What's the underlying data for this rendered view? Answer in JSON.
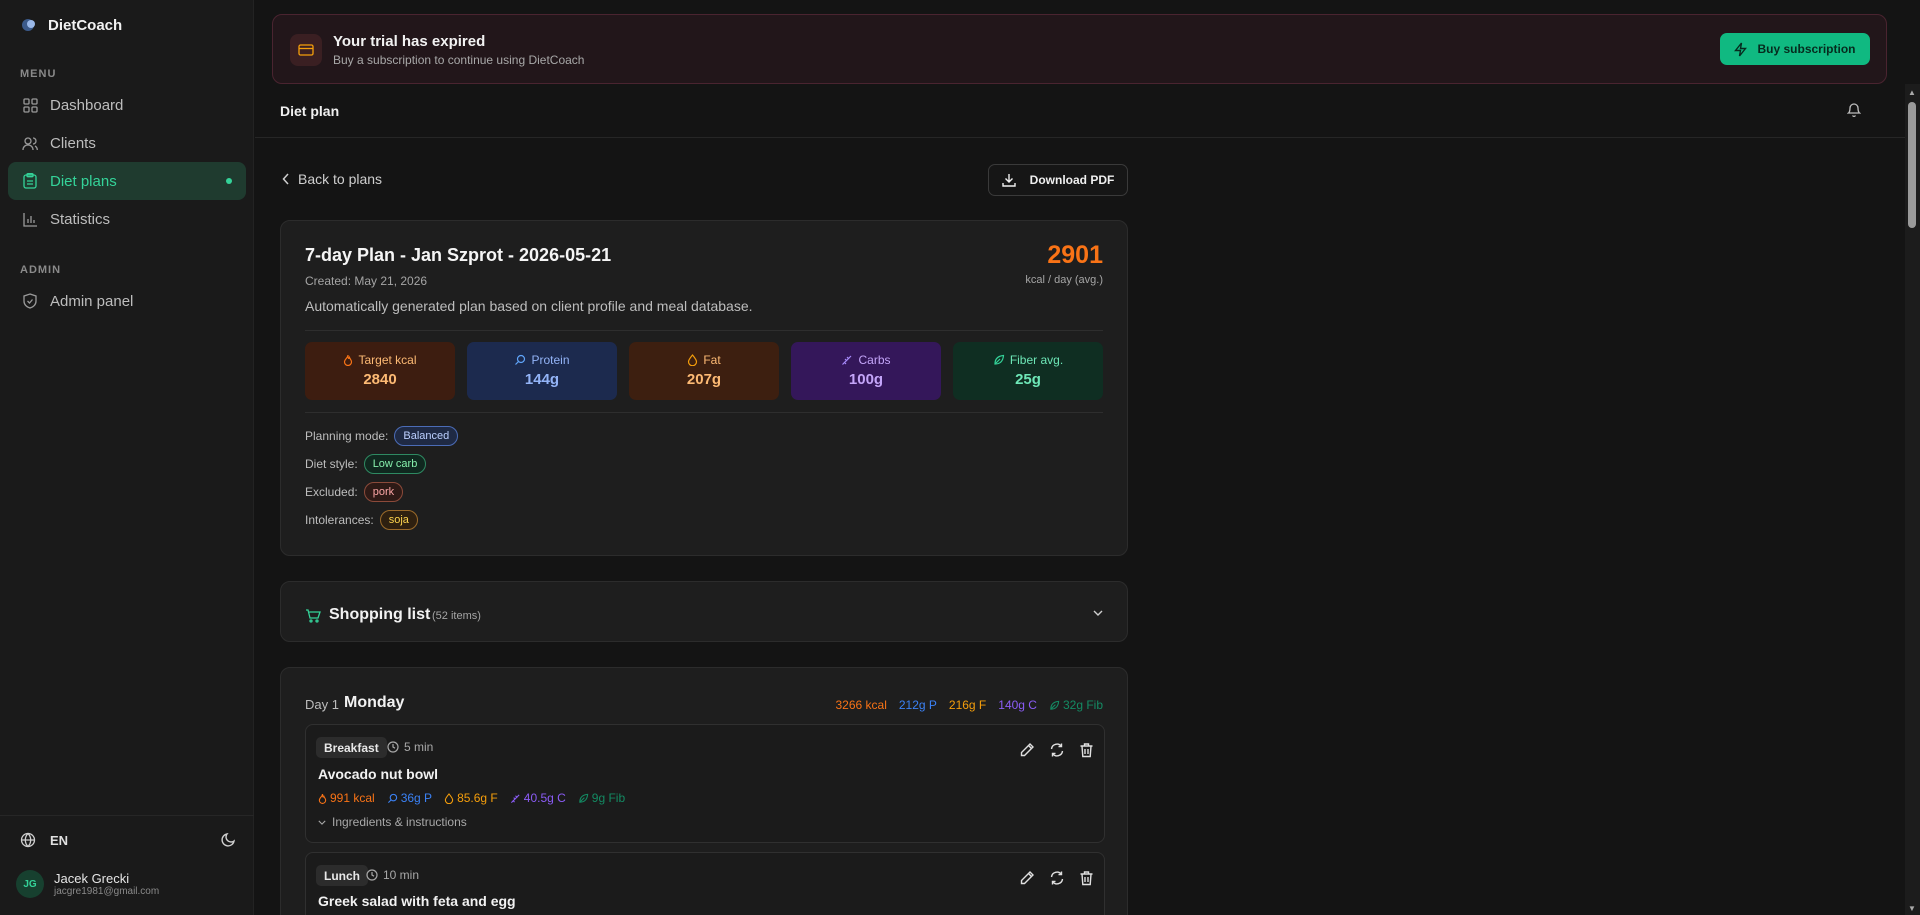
{
  "app": {
    "name": "DietCoach"
  },
  "sidebar": {
    "menu_label": "MENU",
    "items": [
      {
        "label": "Dashboard",
        "icon": "grid-icon"
      },
      {
        "label": "Clients",
        "icon": "users-icon"
      },
      {
        "label": "Diet plans",
        "icon": "clipboard-icon",
        "active": true
      },
      {
        "label": "Statistics",
        "icon": "bar-chart-icon"
      }
    ],
    "admin_label": "ADMIN",
    "admin_items": [
      {
        "label": "Admin panel",
        "icon": "shield-icon"
      }
    ],
    "language": "EN",
    "user": {
      "initials": "JG",
      "name": "Jacek Grecki",
      "email": "jacgre1981@gmail.com"
    }
  },
  "banner": {
    "title": "Your trial has expired",
    "subtitle": "Buy a subscription to continue using DietCoach",
    "button": "Buy subscription"
  },
  "topbar": {
    "title": "Diet plan"
  },
  "actions": {
    "back": "Back to plans",
    "download": "Download PDF"
  },
  "plan": {
    "title": "7-day Plan - Jan Szprot - 2026-05-21",
    "created": "Created: May 21, 2026",
    "description": "Automatically generated plan based on client profile and meal database.",
    "kcal_avg": "2901",
    "kcal_unit": "kcal / day (avg.)",
    "macros": [
      {
        "label": "Target kcal",
        "value": "2840"
      },
      {
        "label": "Protein",
        "value": "144g"
      },
      {
        "label": "Fat",
        "value": "207g"
      },
      {
        "label": "Carbs",
        "value": "100g"
      },
      {
        "label": "Fiber avg.",
        "value": "25g"
      }
    ],
    "properties": [
      {
        "label": "Planning mode:",
        "value": "Balanced"
      },
      {
        "label": "Diet style:",
        "value": "Low carb"
      },
      {
        "label": "Excluded:",
        "value": "pork"
      },
      {
        "label": "Intolerances:",
        "value": "soja"
      }
    ]
  },
  "shopping": {
    "title": "Shopping list",
    "count": "(52 items)"
  },
  "day": {
    "label": "Day 1",
    "name": "Monday",
    "kcal": "3266 kcal",
    "protein": "212g P",
    "fat": "216g F",
    "carbs": "140g C",
    "fiber": "32g Fib",
    "meals": [
      {
        "tag": "Breakfast",
        "time": "5 min",
        "name": "Avocado nut bowl",
        "kcal": "991 kcal",
        "protein": "36g P",
        "fat": "85.6g F",
        "carbs": "40.5g C",
        "fiber": "9g Fib",
        "ingredients_label": "Ingredients & instructions"
      },
      {
        "tag": "Lunch",
        "time": "10 min",
        "name": "Greek salad with feta and egg"
      }
    ]
  },
  "colors": {
    "accent": "#10b981",
    "kcal": "#f97316",
    "protein": "#3b82f6",
    "fat": "#f59e0b",
    "carbs": "#8b5cf6"
  }
}
